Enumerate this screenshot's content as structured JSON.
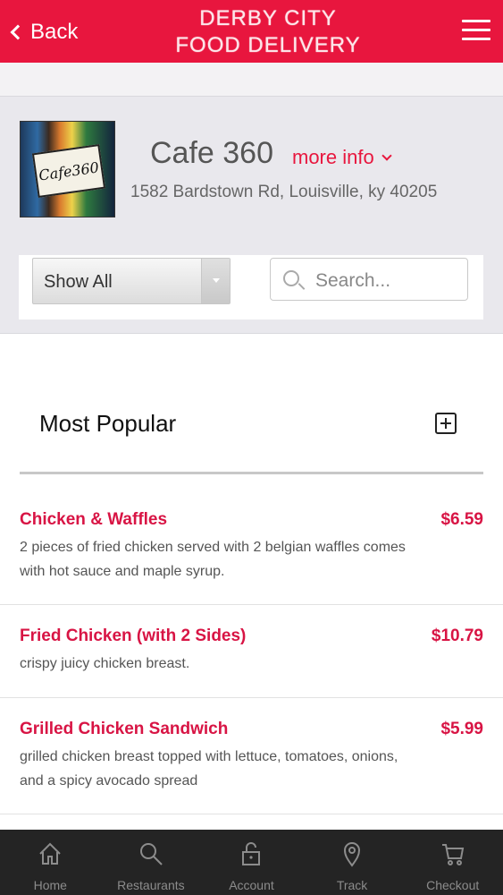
{
  "header": {
    "back_label": "Back",
    "brand_line1": "DERBY CITY",
    "brand_line2": "FOOD DELIVERY",
    "accent_color": "#e8163e"
  },
  "restaurant": {
    "logo_text": "Cafe360",
    "name": "Cafe 360",
    "more_info_label": "more info",
    "address": "1582 Bardstown Rd, Louisville, ky 40205"
  },
  "filter": {
    "selected": "Show All",
    "search_placeholder": "Search..."
  },
  "section": {
    "title": "Most Popular"
  },
  "items": [
    {
      "name": "Chicken & Waffles",
      "price": "$6.59",
      "desc_line1": "2 pieces of fried chicken served with 2 belgian waffles comes",
      "desc_line2": "with hot sauce and maple syrup."
    },
    {
      "name": "Fried Chicken (with 2 Sides)",
      "price": "$10.79",
      "desc_line1": "crispy juicy chicken breast.",
      "desc_line2": ""
    },
    {
      "name": "Grilled Chicken Sandwich",
      "price": "$5.99",
      "desc_line1": "grilled chicken breast topped with lettuce, tomatoes, onions,",
      "desc_line2": "and a spicy avocado spread"
    }
  ],
  "tabs": [
    {
      "label": "Home",
      "icon": "home-icon"
    },
    {
      "label": "Restaurants",
      "icon": "search-icon"
    },
    {
      "label": "Account",
      "icon": "lock-icon"
    },
    {
      "label": "Track",
      "icon": "location-pin-icon"
    },
    {
      "label": "Checkout",
      "icon": "cart-icon"
    }
  ]
}
